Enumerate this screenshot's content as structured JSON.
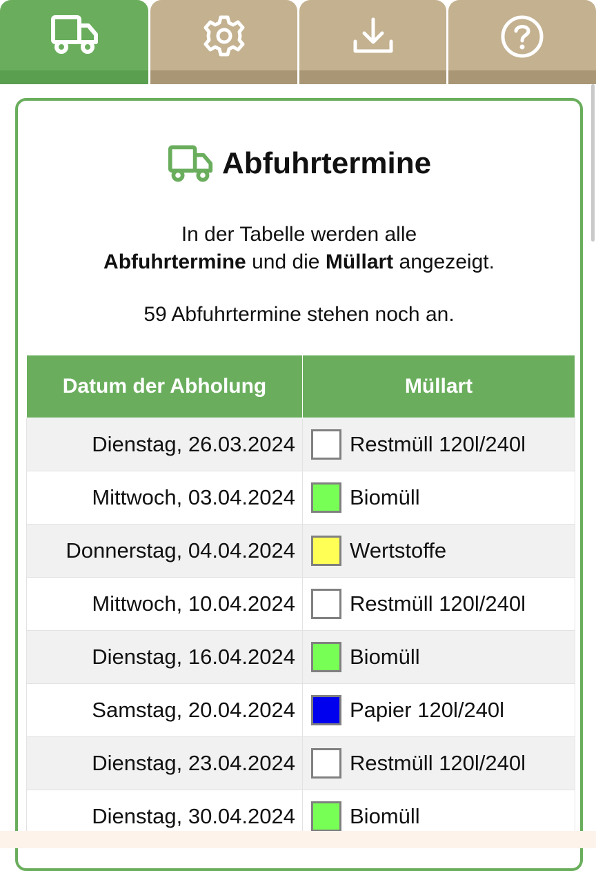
{
  "tabs": [
    {
      "icon": "truck-icon",
      "active": true
    },
    {
      "icon": "gear-icon",
      "active": false
    },
    {
      "icon": "download-icon",
      "active": false
    },
    {
      "icon": "help-icon",
      "active": false
    }
  ],
  "colors": {
    "accent_green": "#6aae5d",
    "tab_inactive": "#c3b190",
    "restmuell": "#ffffff",
    "biomuell": "#77ff55",
    "wertstoffe": "#ffff55",
    "papier": "#0000ee"
  },
  "header": {
    "title": "Abfuhrtermine",
    "icon": "truck-icon"
  },
  "intro": {
    "line1": "In der Tabelle werden alle",
    "bold1": "Abfuhrtermine",
    "mid": " und die ",
    "bold2": "Müllart",
    "end": " angezeigt."
  },
  "remaining_text": "59 Abfuhrtermine stehen noch an.",
  "table": {
    "headers": [
      "Datum der Abholung",
      "Müllart"
    ],
    "rows": [
      {
        "date": "Dienstag, 26.03.2024",
        "type": "Restmüll 120l/240l",
        "color": "#ffffff"
      },
      {
        "date": "Mittwoch, 03.04.2024",
        "type": "Biomüll",
        "color": "#77ff55"
      },
      {
        "date": "Donnerstag, 04.04.2024",
        "type": "Wertstoffe",
        "color": "#ffff55"
      },
      {
        "date": "Mittwoch, 10.04.2024",
        "type": "Restmüll 120l/240l",
        "color": "#ffffff"
      },
      {
        "date": "Dienstag, 16.04.2024",
        "type": "Biomüll",
        "color": "#77ff55"
      },
      {
        "date": "Samstag, 20.04.2024",
        "type": "Papier 120l/240l",
        "color": "#0000ee"
      },
      {
        "date": "Dienstag, 23.04.2024",
        "type": "Restmüll 120l/240l",
        "color": "#ffffff"
      },
      {
        "date": "Dienstag, 30.04.2024",
        "type": "Biomüll",
        "color": "#77ff55"
      }
    ]
  }
}
